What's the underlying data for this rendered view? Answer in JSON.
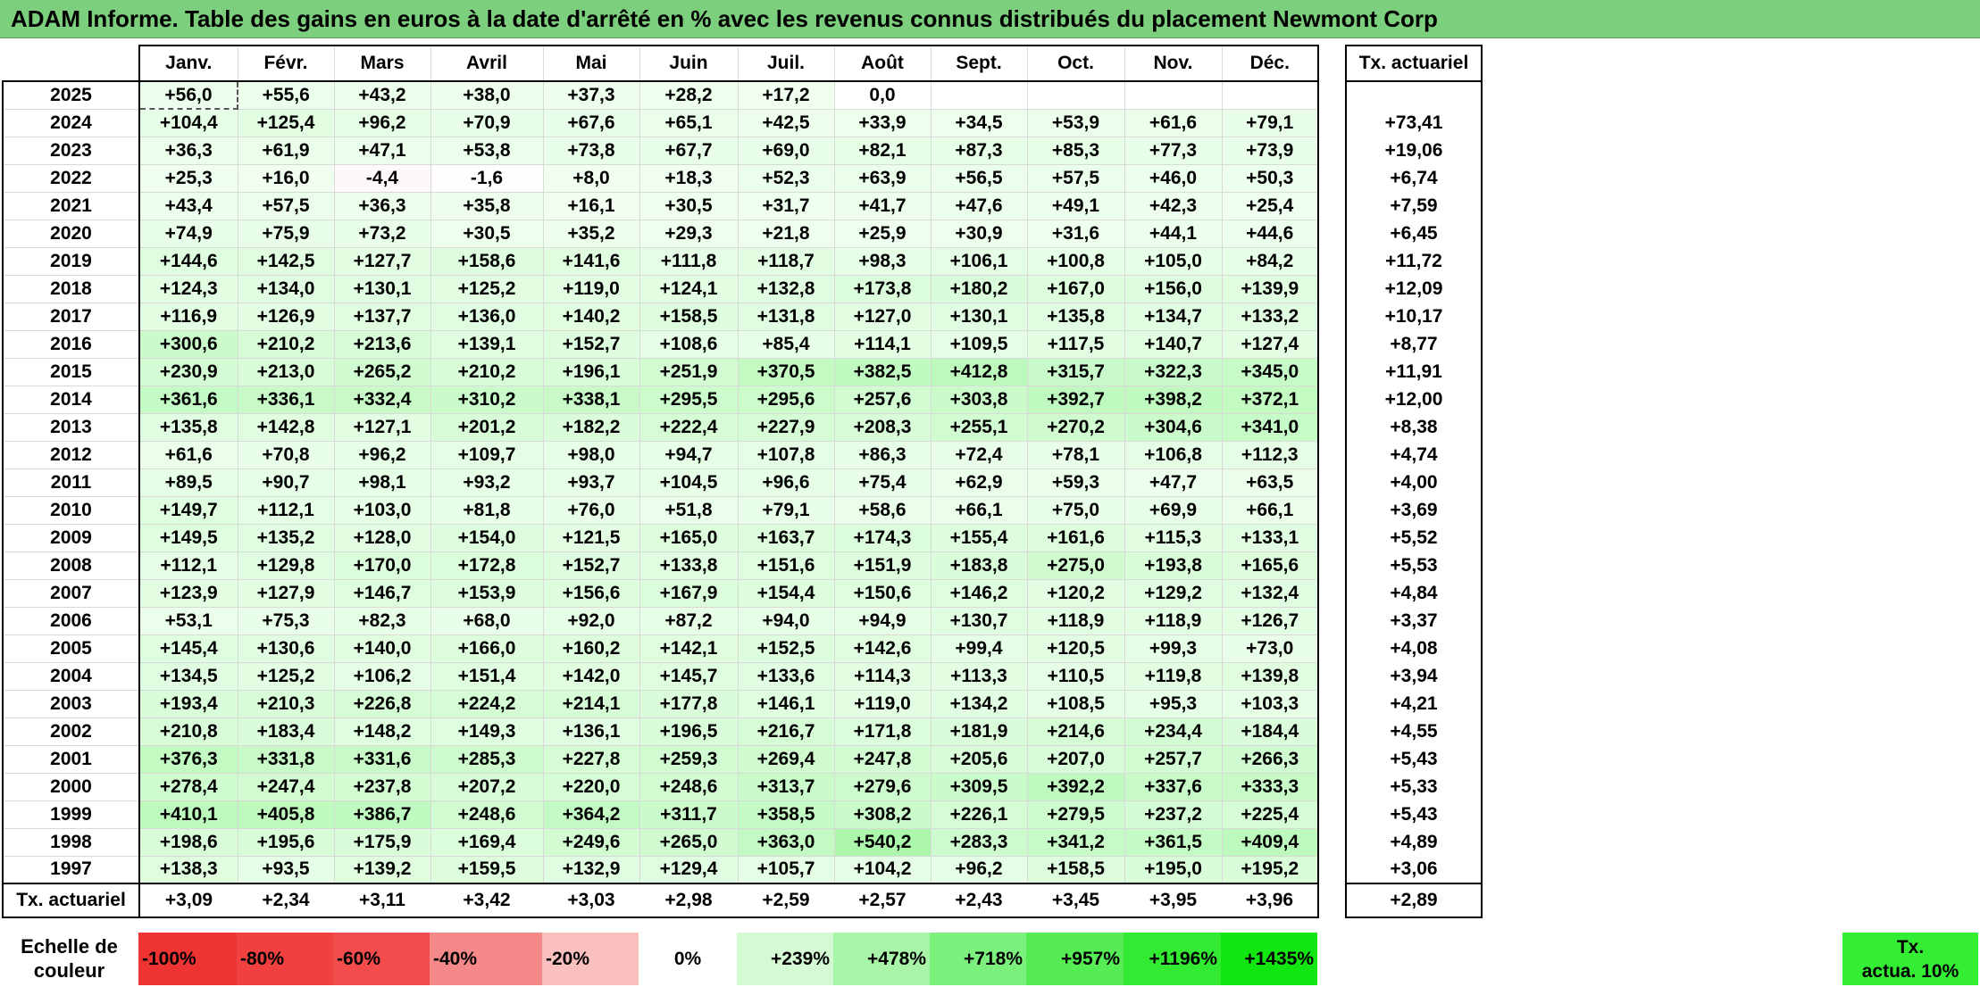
{
  "title": "ADAM Informe. Table des gains en euros à la date d'arrêté en % avec les revenus connus distribués du placement Newmont Corp",
  "header": {
    "months": [
      "Janv.",
      "Févr.",
      "Mars",
      "Avril",
      "Mai",
      "Juin",
      "Juil.",
      "Août",
      "Sept.",
      "Oct.",
      "Nov.",
      "Déc."
    ],
    "rate_label": "Tx. actuariel"
  },
  "rows": [
    {
      "year": "2025",
      "values": [
        "+56,0",
        "+55,6",
        "+43,2",
        "+38,0",
        "+37,3",
        "+28,2",
        "+17,2",
        "0,0",
        "",
        "",
        "",
        ""
      ],
      "rate": ""
    },
    {
      "year": "2024",
      "values": [
        "+104,4",
        "+125,4",
        "+96,2",
        "+70,9",
        "+67,6",
        "+65,1",
        "+42,5",
        "+33,9",
        "+34,5",
        "+53,9",
        "+61,6",
        "+79,1"
      ],
      "rate": "+73,41"
    },
    {
      "year": "2023",
      "values": [
        "+36,3",
        "+61,9",
        "+47,1",
        "+53,8",
        "+73,8",
        "+67,7",
        "+69,0",
        "+82,1",
        "+87,3",
        "+85,3",
        "+77,3",
        "+73,9"
      ],
      "rate": "+19,06"
    },
    {
      "year": "2022",
      "values": [
        "+25,3",
        "+16,0",
        "-4,4",
        "-1,6",
        "+8,0",
        "+18,3",
        "+52,3",
        "+63,9",
        "+56,5",
        "+57,5",
        "+46,0",
        "+50,3"
      ],
      "rate": "+6,74"
    },
    {
      "year": "2021",
      "values": [
        "+43,4",
        "+57,5",
        "+36,3",
        "+35,8",
        "+16,1",
        "+30,5",
        "+31,7",
        "+41,7",
        "+47,6",
        "+49,1",
        "+42,3",
        "+25,4"
      ],
      "rate": "+7,59"
    },
    {
      "year": "2020",
      "values": [
        "+74,9",
        "+75,9",
        "+73,2",
        "+30,5",
        "+35,2",
        "+29,3",
        "+21,8",
        "+25,9",
        "+30,9",
        "+31,6",
        "+44,1",
        "+44,6"
      ],
      "rate": "+6,45"
    },
    {
      "year": "2019",
      "values": [
        "+144,6",
        "+142,5",
        "+127,7",
        "+158,6",
        "+141,6",
        "+111,8",
        "+118,7",
        "+98,3",
        "+106,1",
        "+100,8",
        "+105,0",
        "+84,2"
      ],
      "rate": "+11,72"
    },
    {
      "year": "2018",
      "values": [
        "+124,3",
        "+134,0",
        "+130,1",
        "+125,2",
        "+119,0",
        "+124,1",
        "+132,8",
        "+173,8",
        "+180,2",
        "+167,0",
        "+156,0",
        "+139,9"
      ],
      "rate": "+12,09"
    },
    {
      "year": "2017",
      "values": [
        "+116,9",
        "+126,9",
        "+137,7",
        "+136,0",
        "+140,2",
        "+158,5",
        "+131,8",
        "+127,0",
        "+130,1",
        "+135,8",
        "+134,7",
        "+133,2"
      ],
      "rate": "+10,17"
    },
    {
      "year": "2016",
      "values": [
        "+300,6",
        "+210,2",
        "+213,6",
        "+139,1",
        "+152,7",
        "+108,6",
        "+85,4",
        "+114,1",
        "+109,5",
        "+117,5",
        "+140,7",
        "+127,4"
      ],
      "rate": "+8,77"
    },
    {
      "year": "2015",
      "values": [
        "+230,9",
        "+213,0",
        "+265,2",
        "+210,2",
        "+196,1",
        "+251,9",
        "+370,5",
        "+382,5",
        "+412,8",
        "+315,7",
        "+322,3",
        "+345,0"
      ],
      "rate": "+11,91"
    },
    {
      "year": "2014",
      "values": [
        "+361,6",
        "+336,1",
        "+332,4",
        "+310,2",
        "+338,1",
        "+295,5",
        "+295,6",
        "+257,6",
        "+303,8",
        "+392,7",
        "+398,2",
        "+372,1"
      ],
      "rate": "+12,00"
    },
    {
      "year": "2013",
      "values": [
        "+135,8",
        "+142,8",
        "+127,1",
        "+201,2",
        "+182,2",
        "+222,4",
        "+227,9",
        "+208,3",
        "+255,1",
        "+270,2",
        "+304,6",
        "+341,0"
      ],
      "rate": "+8,38"
    },
    {
      "year": "2012",
      "values": [
        "+61,6",
        "+70,8",
        "+96,2",
        "+109,7",
        "+98,0",
        "+94,7",
        "+107,8",
        "+86,3",
        "+72,4",
        "+78,1",
        "+106,8",
        "+112,3"
      ],
      "rate": "+4,74"
    },
    {
      "year": "2011",
      "values": [
        "+89,5",
        "+90,7",
        "+98,1",
        "+93,2",
        "+93,7",
        "+104,5",
        "+96,6",
        "+75,4",
        "+62,9",
        "+59,3",
        "+47,7",
        "+63,5"
      ],
      "rate": "+4,00"
    },
    {
      "year": "2010",
      "values": [
        "+149,7",
        "+112,1",
        "+103,0",
        "+81,8",
        "+76,0",
        "+51,8",
        "+79,1",
        "+58,6",
        "+66,1",
        "+75,0",
        "+69,9",
        "+66,1"
      ],
      "rate": "+3,69"
    },
    {
      "year": "2009",
      "values": [
        "+149,5",
        "+135,2",
        "+128,0",
        "+154,0",
        "+121,5",
        "+165,0",
        "+163,7",
        "+174,3",
        "+155,4",
        "+161,6",
        "+115,3",
        "+133,1"
      ],
      "rate": "+5,52"
    },
    {
      "year": "2008",
      "values": [
        "+112,1",
        "+129,8",
        "+170,0",
        "+172,8",
        "+152,7",
        "+133,8",
        "+151,6",
        "+151,9",
        "+183,8",
        "+275,0",
        "+193,8",
        "+165,6"
      ],
      "rate": "+5,53"
    },
    {
      "year": "2007",
      "values": [
        "+123,9",
        "+127,9",
        "+146,7",
        "+153,9",
        "+156,6",
        "+167,9",
        "+154,4",
        "+150,6",
        "+146,2",
        "+120,2",
        "+129,2",
        "+132,4"
      ],
      "rate": "+4,84"
    },
    {
      "year": "2006",
      "values": [
        "+53,1",
        "+75,3",
        "+82,3",
        "+68,0",
        "+92,0",
        "+87,2",
        "+94,0",
        "+94,9",
        "+130,7",
        "+118,9",
        "+118,9",
        "+126,7"
      ],
      "rate": "+3,37"
    },
    {
      "year": "2005",
      "values": [
        "+145,4",
        "+130,6",
        "+140,0",
        "+166,0",
        "+160,2",
        "+142,1",
        "+152,5",
        "+142,6",
        "+99,4",
        "+120,5",
        "+99,3",
        "+73,0"
      ],
      "rate": "+4,08"
    },
    {
      "year": "2004",
      "values": [
        "+134,5",
        "+125,2",
        "+106,2",
        "+151,4",
        "+142,0",
        "+145,7",
        "+133,6",
        "+114,3",
        "+113,3",
        "+110,5",
        "+119,8",
        "+139,8"
      ],
      "rate": "+3,94"
    },
    {
      "year": "2003",
      "values": [
        "+193,4",
        "+210,3",
        "+226,8",
        "+224,2",
        "+214,1",
        "+177,8",
        "+146,1",
        "+119,0",
        "+134,2",
        "+108,5",
        "+95,3",
        "+103,3"
      ],
      "rate": "+4,21"
    },
    {
      "year": "2002",
      "values": [
        "+210,8",
        "+183,4",
        "+148,2",
        "+149,3",
        "+136,1",
        "+196,5",
        "+216,7",
        "+171,8",
        "+181,9",
        "+214,6",
        "+234,4",
        "+184,4"
      ],
      "rate": "+4,55"
    },
    {
      "year": "2001",
      "values": [
        "+376,3",
        "+331,8",
        "+331,6",
        "+285,3",
        "+227,8",
        "+259,3",
        "+269,4",
        "+247,8",
        "+205,6",
        "+207,0",
        "+257,7",
        "+266,3"
      ],
      "rate": "+5,43"
    },
    {
      "year": "2000",
      "values": [
        "+278,4",
        "+247,4",
        "+237,8",
        "+207,2",
        "+220,0",
        "+248,6",
        "+313,7",
        "+279,6",
        "+309,5",
        "+392,2",
        "+337,6",
        "+333,3"
      ],
      "rate": "+5,33"
    },
    {
      "year": "1999",
      "values": [
        "+410,1",
        "+405,8",
        "+386,7",
        "+248,6",
        "+364,2",
        "+311,7",
        "+358,5",
        "+308,2",
        "+226,1",
        "+279,5",
        "+237,2",
        "+225,4"
      ],
      "rate": "+5,43"
    },
    {
      "year": "1998",
      "values": [
        "+198,6",
        "+195,6",
        "+175,9",
        "+169,4",
        "+249,6",
        "+265,0",
        "+363,0",
        "+540,2",
        "+283,3",
        "+341,2",
        "+361,5",
        "+409,4"
      ],
      "rate": "+4,89"
    },
    {
      "year": "1997",
      "values": [
        "+138,3",
        "+93,5",
        "+139,2",
        "+159,5",
        "+132,9",
        "+129,4",
        "+105,7",
        "+104,2",
        "+96,2",
        "+158,5",
        "+195,0",
        "+195,2"
      ],
      "rate": "+3,06"
    }
  ],
  "footer": {
    "label": "Tx. actuariel",
    "values": [
      "+3,09",
      "+2,34",
      "+3,11",
      "+3,42",
      "+3,03",
      "+2,98",
      "+2,59",
      "+2,57",
      "+2,43",
      "+3,45",
      "+3,95",
      "+3,96"
    ],
    "rate": "+2,89"
  },
  "scale": {
    "label_line1": "Echelle de",
    "label_line2": "couleur",
    "steps": [
      {
        "text": "-100%",
        "color": "#ee3333",
        "kind": "neg"
      },
      {
        "text": "-80%",
        "color": "#f04040",
        "kind": "neg"
      },
      {
        "text": "-60%",
        "color": "#f24c4c",
        "kind": "neg"
      },
      {
        "text": "-40%",
        "color": "#f58888",
        "kind": "neg"
      },
      {
        "text": "-20%",
        "color": "#fac0c0",
        "kind": "neg"
      },
      {
        "text": "0%",
        "color": "#ffffff",
        "kind": "zero"
      },
      {
        "text": "+239%",
        "color": "#d3fad3",
        "kind": "pos"
      },
      {
        "text": "+478%",
        "color": "#a8f5a8",
        "kind": "pos"
      },
      {
        "text": "+718%",
        "color": "#7cf07c",
        "kind": "pos"
      },
      {
        "text": "+957%",
        "color": "#55ec55",
        "kind": "pos"
      },
      {
        "text": "+1196%",
        "color": "#33ea33",
        "kind": "pos"
      },
      {
        "text": "+1435%",
        "color": "#11e611",
        "kind": "pos"
      }
    ],
    "ta_line1": "Tx.",
    "ta_line2": "actua. 10%"
  }
}
